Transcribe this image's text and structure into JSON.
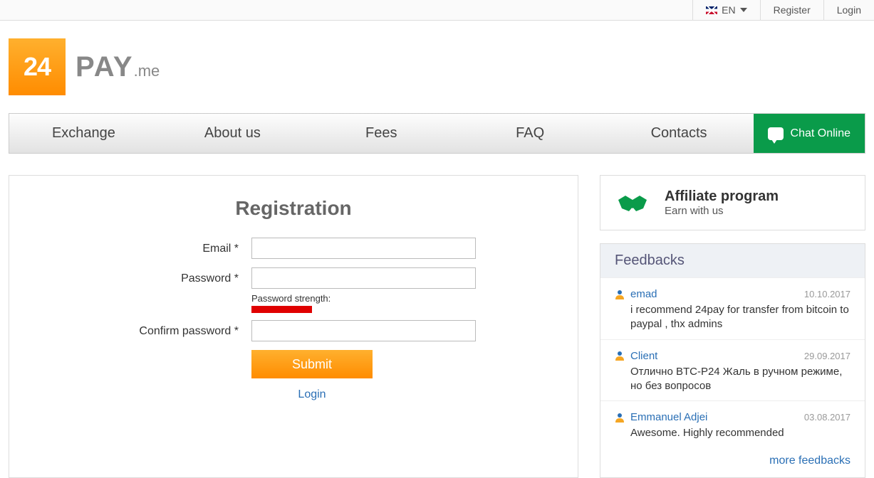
{
  "topbar": {
    "lang": "EN",
    "register": "Register",
    "login": "Login"
  },
  "logo": {
    "square": "24",
    "text": "PAY",
    "suffix": ".me"
  },
  "nav": {
    "items": [
      "Exchange",
      "About us",
      "Fees",
      "FAQ",
      "Contacts"
    ],
    "chat": "Chat Online"
  },
  "registration": {
    "title": "Registration",
    "email_label": "Email *",
    "password_label": "Password *",
    "strength_label": "Password strength:",
    "confirm_label": "Confirm password *",
    "submit": "Submit",
    "login_link": "Login"
  },
  "affiliate": {
    "title": "Affiliate program",
    "subtitle": "Earn with us"
  },
  "feedbacks": {
    "heading": "Feedbacks",
    "items": [
      {
        "user": "emad",
        "date": "10.10.2017",
        "text": "i recommend 24pay for transfer from bitcoin to paypal , thx admins"
      },
      {
        "user": "Client",
        "date": "29.09.2017",
        "text": "Отлично BTC-P24 Жаль в ручном режиме, но без вопросов"
      },
      {
        "user": "Emmanuel Adjei",
        "date": "03.08.2017",
        "text": "Awesome. Highly recommended"
      }
    ],
    "more": "more feedbacks"
  }
}
